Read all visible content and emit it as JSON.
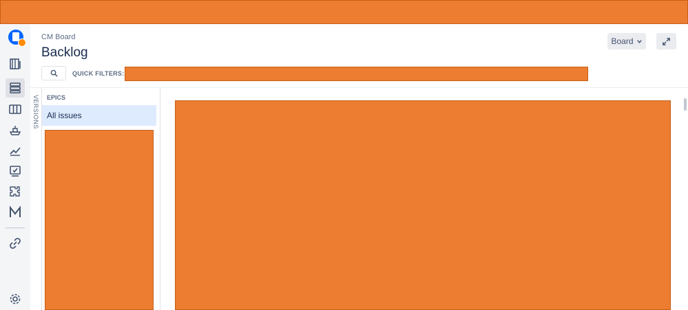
{
  "header": {
    "breadcrumb": "CM Board",
    "title": "Backlog",
    "board_button": "Board"
  },
  "sidebar": {
    "icons": [
      "backlog-icon",
      "list-icon",
      "board-icon",
      "release-icon",
      "reports-icon",
      "tests-icon",
      "addon-icon",
      "m-icon",
      "link-icon",
      "settings-icon"
    ]
  },
  "filters": {
    "quick_filters_label": "QUICK FILTERS:"
  },
  "versions": {
    "label": "VERSIONS"
  },
  "epics": {
    "title": "EPICS",
    "all_issues": "All issues"
  },
  "colors": {
    "accent": "#0065ff",
    "selected": "#deebff",
    "redaction": "#ed7d31"
  }
}
